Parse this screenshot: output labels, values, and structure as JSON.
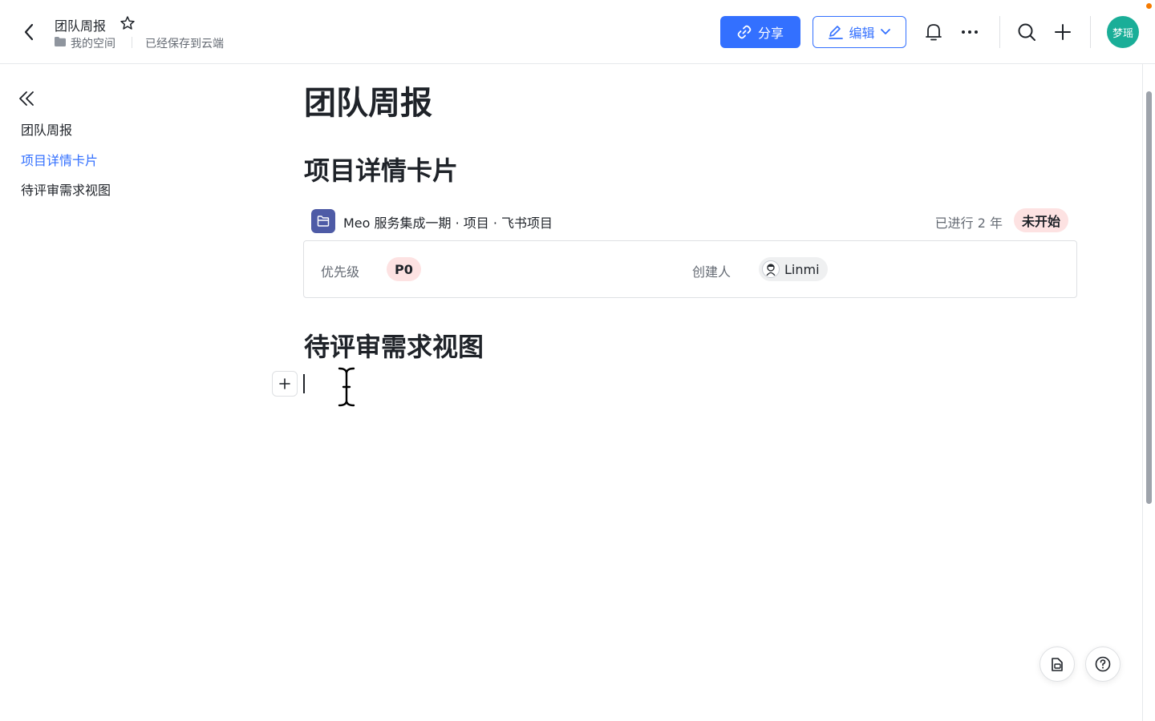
{
  "header": {
    "doc_title": "团队周报",
    "space": "我的空间",
    "save_status": "已经保存到云端",
    "share_label": "分享",
    "edit_label": "编辑",
    "avatar_text": "梦瑶",
    "icons": [
      "back-icon",
      "star-icon",
      "folder-icon",
      "link-icon",
      "pencil-icon",
      "chevron-down-icon",
      "bell-icon",
      "more-icon",
      "search-icon",
      "plus-icon"
    ]
  },
  "sidebar": {
    "items": [
      {
        "label": "团队周报",
        "active": false
      },
      {
        "label": "项目详情卡片",
        "active": true
      },
      {
        "label": "待评审需求视图",
        "active": false
      }
    ]
  },
  "document": {
    "title": "团队周报",
    "sections": [
      {
        "heading": "项目详情卡片"
      },
      {
        "heading": "待评审需求视图"
      }
    ],
    "project_card": {
      "title": "Meo 服务集成一期 · 项目 · 飞书项目",
      "elapsed": "已进行 2 年",
      "status": "未开始",
      "fields": [
        {
          "label": "优先级",
          "value": "P0"
        },
        {
          "label": "创建人",
          "value": "Linmi"
        }
      ]
    }
  },
  "colors": {
    "accent": "#3370ff",
    "badge_bg": "#fde2e2",
    "avatar_bg": "#1aae98",
    "project_icon_bg": "#4e5ba6",
    "notification_dot": "#f57a00"
  }
}
